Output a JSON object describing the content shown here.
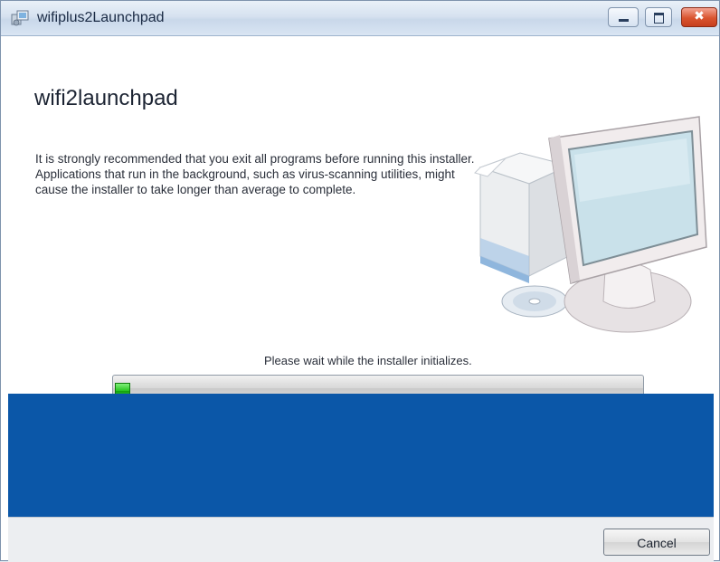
{
  "window": {
    "title": "wifiplus2Launchpad"
  },
  "main": {
    "heading": "wifi2launchpad",
    "description": "It is strongly recommended that you exit all programs before running this installer. Applications that run in the background, such as virus-scanning utilities, might cause the installer to take longer than average to complete.",
    "status": "Please wait while the installer initializes.",
    "progress_fraction": 0.03
  },
  "footer": {
    "cancel_label": "Cancel"
  },
  "colors": {
    "banner": "#0b57a8",
    "progress_fill": "#27c41f"
  },
  "icons": {
    "app": "installer-app-icon",
    "illustration": "computer-with-box-and-disc"
  }
}
